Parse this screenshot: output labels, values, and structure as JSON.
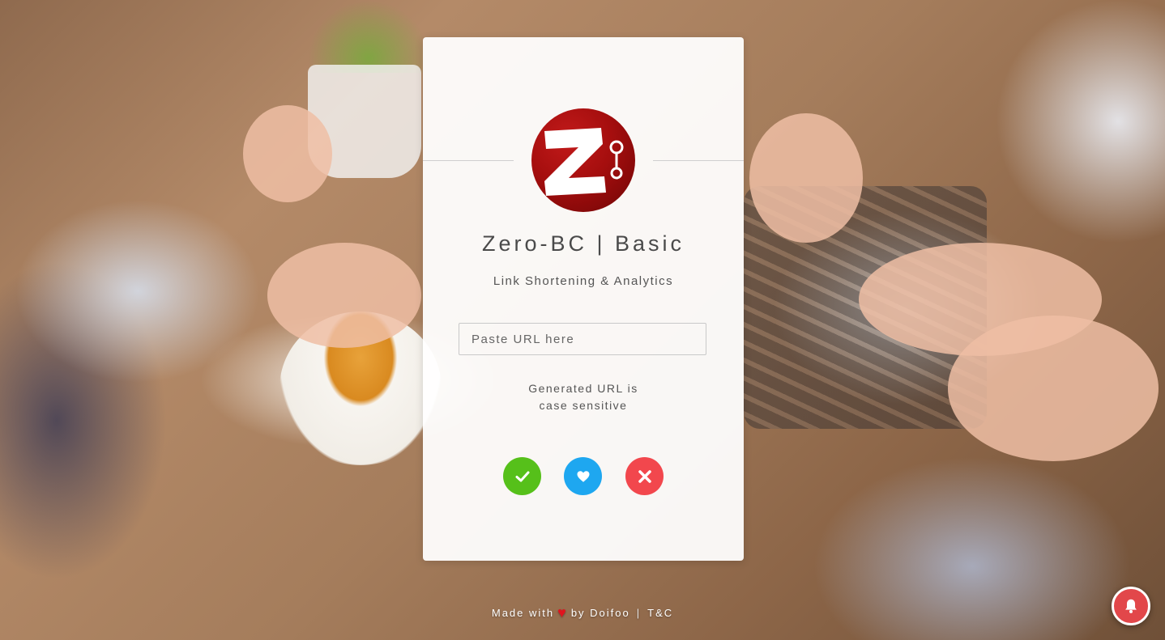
{
  "app": {
    "title": "Zero-BC | Basic",
    "subtitle": "Link Shortening & Analytics",
    "logo_name": "zero-bc-logo"
  },
  "form": {
    "url_placeholder": "Paste URL here",
    "url_value": "",
    "note_line1": "Generated URL is",
    "note_line2": "case sensitive"
  },
  "actions": {
    "confirm_icon": "check-icon",
    "favorite_icon": "heart-icon",
    "cancel_icon": "x-icon"
  },
  "footer": {
    "made_with": "Made with",
    "by_text": "by Doifoo",
    "separator": "|",
    "terms_link": "T&C"
  },
  "notification": {
    "icon": "bell-icon"
  },
  "colors": {
    "confirm": "#56c01a",
    "favorite": "#1ea7f0",
    "cancel": "#f2474d",
    "logo_red": "#a50e0e",
    "bell": "#e2474a"
  }
}
